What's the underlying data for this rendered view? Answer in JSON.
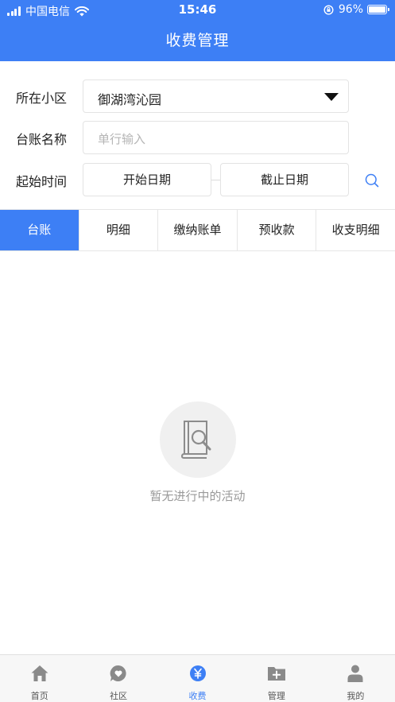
{
  "status_bar": {
    "carrier": "中国电信",
    "time": "15:46",
    "battery": "96%"
  },
  "header": {
    "title": "收费管理"
  },
  "filters": {
    "community_label": "所在小区",
    "community_value": "御湖湾沁园",
    "ledger_label": "台账名称",
    "ledger_placeholder": "单行输入",
    "time_label": "起始时间",
    "start_date": "开始日期",
    "end_date": "截止日期"
  },
  "tabs": [
    {
      "label": "台账",
      "active": true
    },
    {
      "label": "明细",
      "active": false
    },
    {
      "label": "缴纳账单",
      "active": false
    },
    {
      "label": "预收款",
      "active": false
    },
    {
      "label": "收支明细",
      "active": false
    }
  ],
  "empty_state": {
    "icon": "search-document-icon",
    "message": "暂无进行中的活动"
  },
  "tabbar": [
    {
      "label": "首页",
      "icon": "home-icon",
      "active": false
    },
    {
      "label": "社区",
      "icon": "heart-chat-icon",
      "active": false
    },
    {
      "label": "收费",
      "icon": "yen-circle-icon",
      "active": true
    },
    {
      "label": "管理",
      "icon": "folder-plus-icon",
      "active": false
    },
    {
      "label": "我的",
      "icon": "person-icon",
      "active": false
    }
  ],
  "colors": {
    "primary": "#3d7ff5",
    "inactive_icon": "#8a8a8a",
    "empty_text": "#9a9a9a"
  }
}
